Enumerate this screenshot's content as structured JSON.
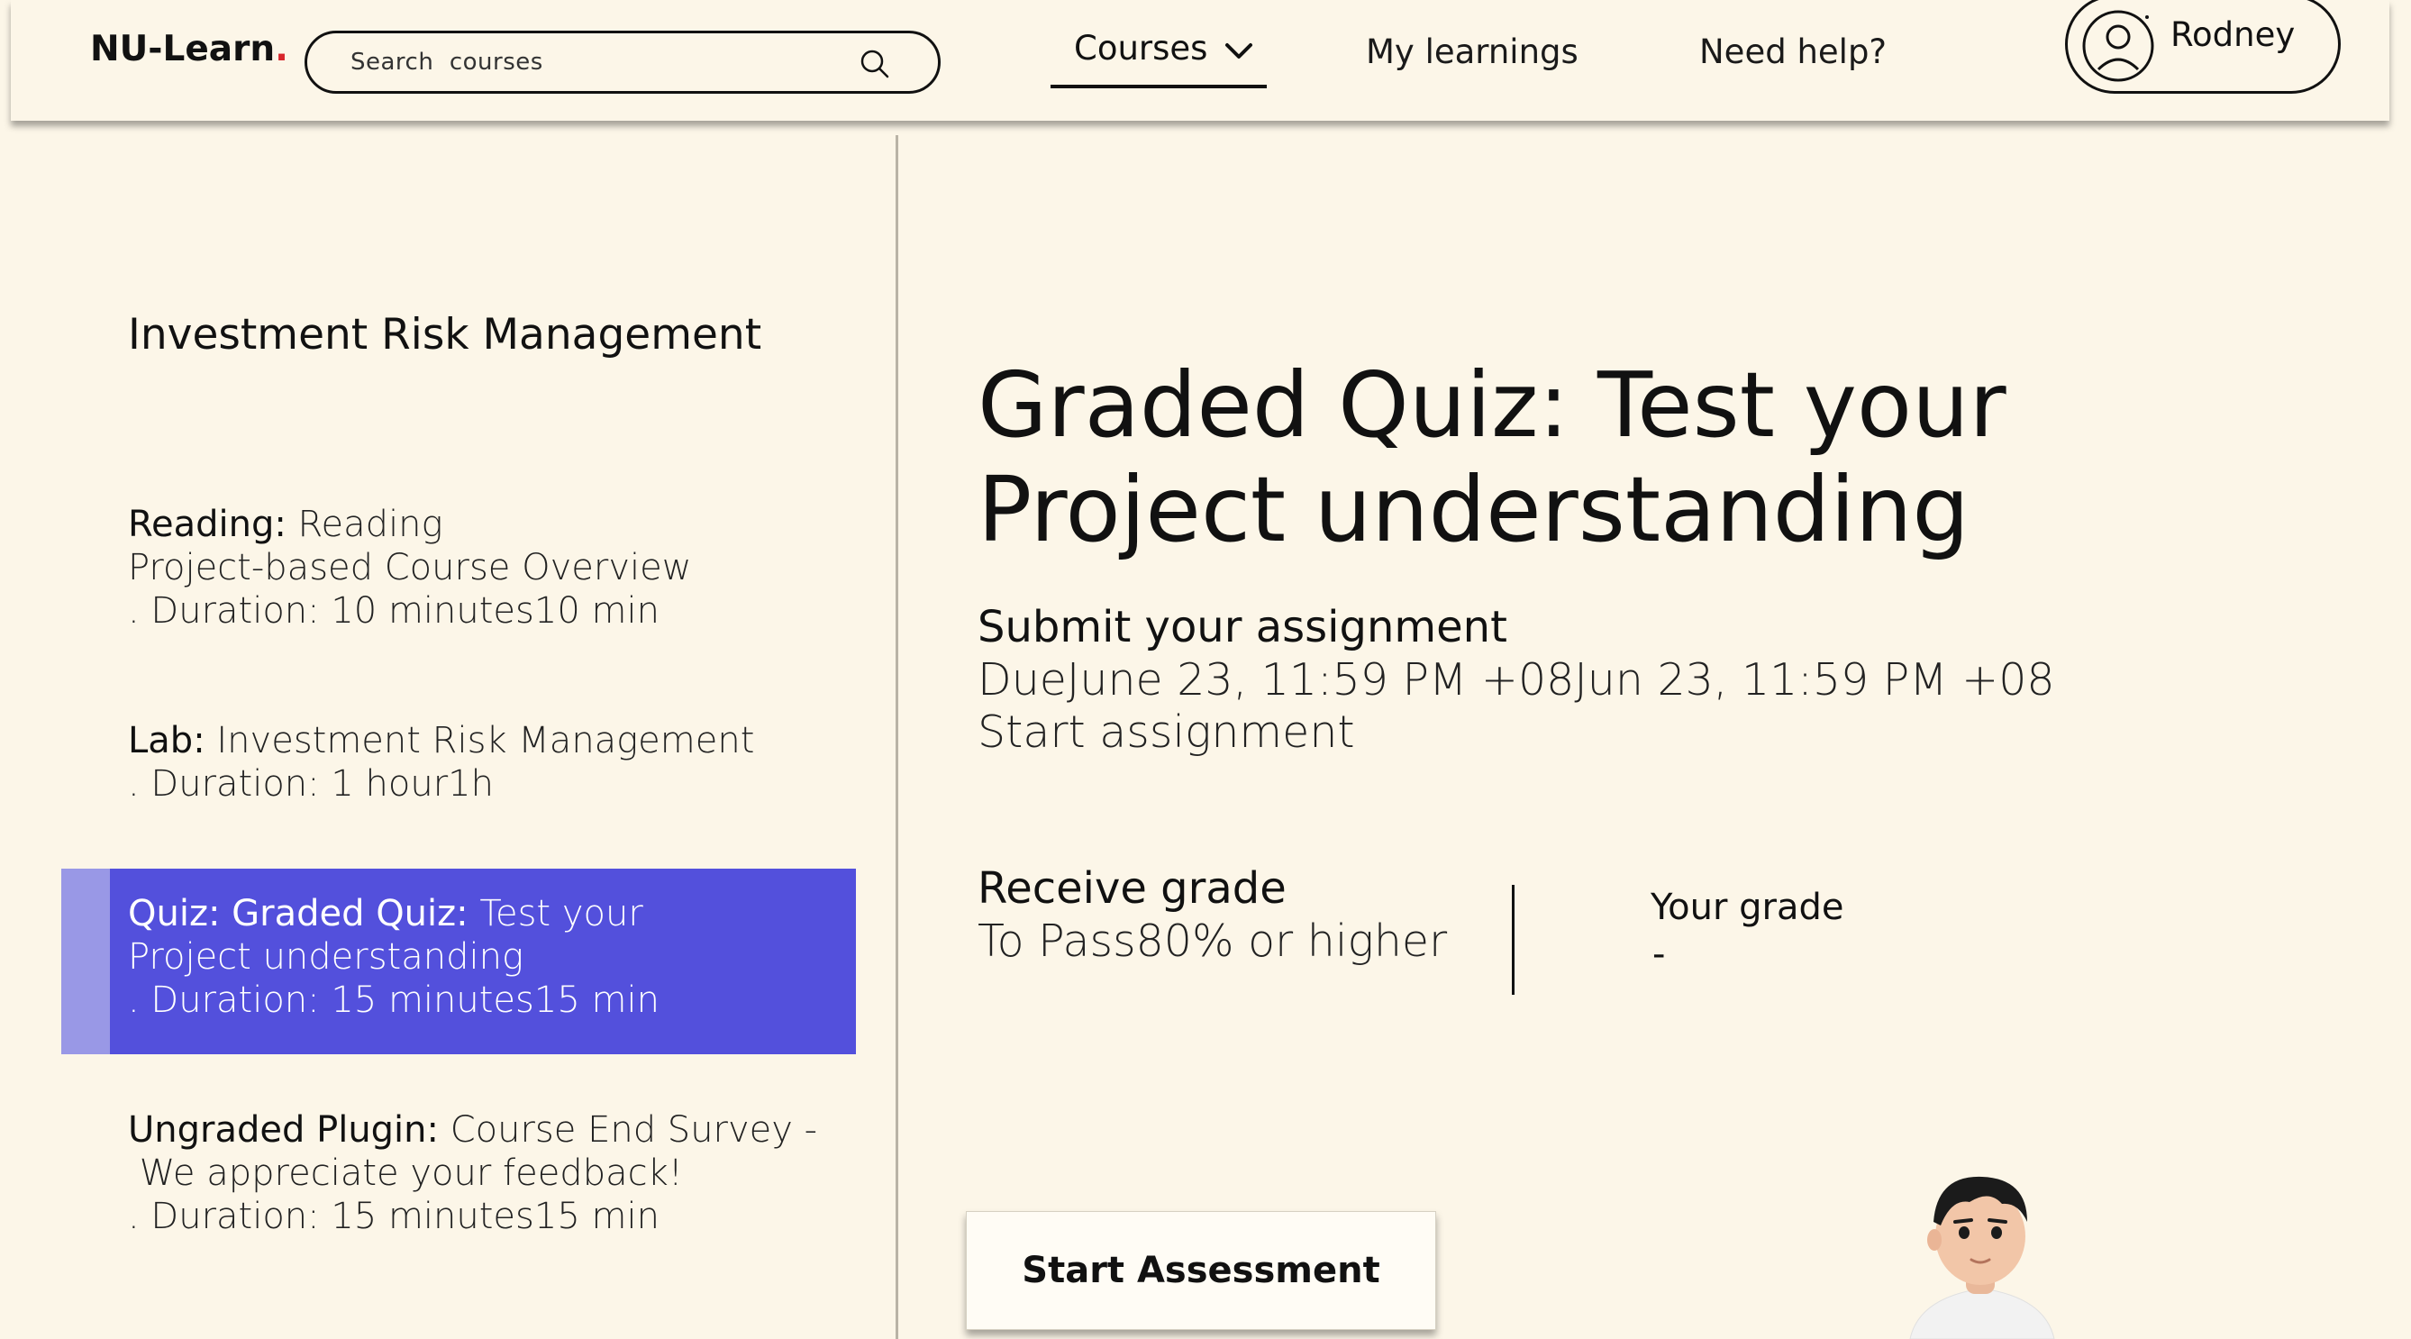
{
  "header": {
    "logo_text": "NU-Learn",
    "logo_dot": ".",
    "search_placeholder": "Search  courses",
    "nav": {
      "courses": "Courses",
      "my_learnings": "My learnings",
      "need_help": "Need help?"
    },
    "user_name": "Rodney"
  },
  "sidebar": {
    "course_title": "Investment Risk Management",
    "modules": [
      {
        "kind": "Reading:",
        "line1": " Reading",
        "line2": "Project-based Course Overview",
        "line3": ". Duration: 10 minutes10 min"
      },
      {
        "kind": "Lab:",
        "line1": " Investment Risk Management",
        "line2": ". Duration: 1 hour1h"
      },
      {
        "kind": "Quiz: Graded Quiz:",
        "line1": " Test your",
        "line2": "Project understanding",
        "line3": ". Duration: 15 minutes15 min",
        "active": true
      },
      {
        "kind": "Ungraded Plugin:",
        "line1": " Course End Survey -",
        "line2": " We appreciate your feedback!",
        "line3": ". Duration: 15 minutes15 min"
      }
    ]
  },
  "main": {
    "title_bold": "Graded Quiz:",
    "title_rest": " Test your",
    "title_line2": "Project understanding",
    "submit_heading": "Submit your assignment",
    "due_text": "DueJune 23, 11:59 PM +08Jun 23, 11:59 PM +08",
    "start_assignment": "Start assignment",
    "receive_heading": "Receive grade",
    "to_pass": "To Pass80% or higher",
    "your_grade_label": "Your grade",
    "your_grade_value": "-",
    "start_button": "Start Assessment"
  },
  "colors": {
    "background": "#fcf6e8",
    "active_module": "#5350dc",
    "active_module_bar": "#9998e6",
    "logo_dot": "#d8262c"
  }
}
